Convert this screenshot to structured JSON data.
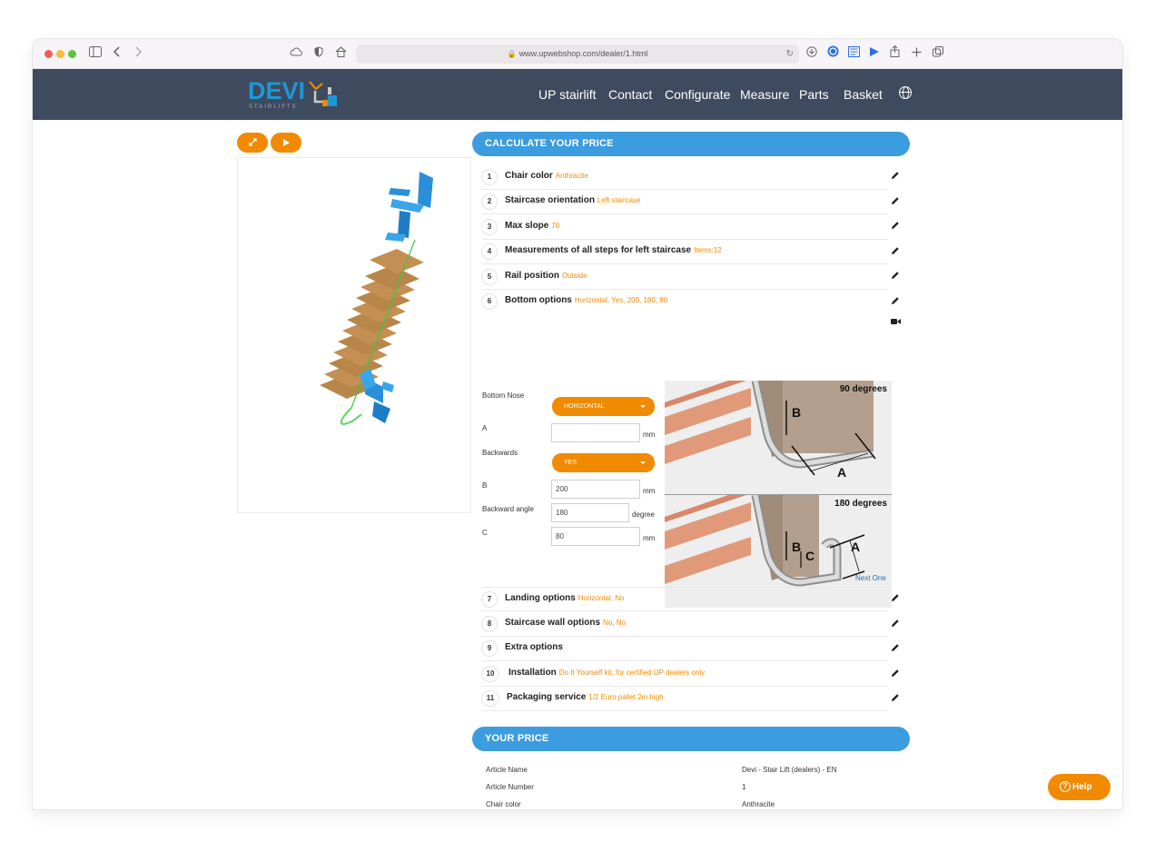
{
  "browser": {
    "url": "www.upwebshop.com/dealer/1.html"
  },
  "navbar": {
    "logo_text": "DEVI",
    "logo_sub": "STAIRLIFTS",
    "items": [
      "UP stairlift",
      "Contact",
      "Configurate",
      "Measure",
      "Parts",
      "Basket"
    ]
  },
  "calculator": {
    "header": "CALCULATE YOUR PRICE",
    "steps_top": [
      {
        "num": "1",
        "title": "Chair color",
        "value": "Anthracite"
      },
      {
        "num": "2",
        "title": "Staircase orientation",
        "value": "Left staircase"
      },
      {
        "num": "3",
        "title": "Max slope",
        "value": "70"
      },
      {
        "num": "4",
        "title": "Measurements of all steps for left staircase",
        "value": "Items:12"
      },
      {
        "num": "5",
        "title": "Rail position",
        "value": "Outside"
      },
      {
        "num": "6",
        "title": "Bottom options",
        "value": "Horizontal, Yes, 200, 180, 80"
      }
    ],
    "bottom_options": {
      "bottom_nose_label": "Bottom Nose",
      "bottom_nose_value": "HORIZONTAL",
      "a_label": "A",
      "a_value": "",
      "a_unit": "mm",
      "backwards_label": "Backwards",
      "backwards_value": "YES",
      "b_label": "B",
      "b_value": "200",
      "b_unit": "mm",
      "angle_label": "Backward angle",
      "angle_value": "180",
      "angle_unit": "degree",
      "c_label": "C",
      "c_value": "80",
      "c_unit": "mm",
      "diagram_90_label": "90 degrees",
      "diagram_180_label": "180 degrees",
      "next_link": "Next One"
    },
    "steps_bottom": [
      {
        "num": "7",
        "title": "Landing options",
        "value": "Horizontal, No"
      },
      {
        "num": "8",
        "title": "Staircase wall options",
        "value": "No, No"
      },
      {
        "num": "9",
        "title": "Extra options",
        "value": ""
      },
      {
        "num": "10",
        "title": "Installation",
        "value": "Do It Yourself kit, for certified UP dealers only"
      },
      {
        "num": "11",
        "title": "Packaging service",
        "value": "1/2 Euro pallet 2m high"
      }
    ]
  },
  "price": {
    "header": "YOUR PRICE",
    "rows": [
      {
        "label": "Article Name",
        "value": "Devi - Stair Lift (dealers) - EN"
      },
      {
        "label": "Article Number",
        "value": "1"
      },
      {
        "label": "Chair color",
        "value": "Anthracite"
      }
    ]
  },
  "help": {
    "label": "Help",
    "icon_glyph": "?"
  },
  "colors": {
    "accent_orange": "#f08a00",
    "header_blue": "#3b9ce0",
    "navbar": "#3e4a5e"
  }
}
